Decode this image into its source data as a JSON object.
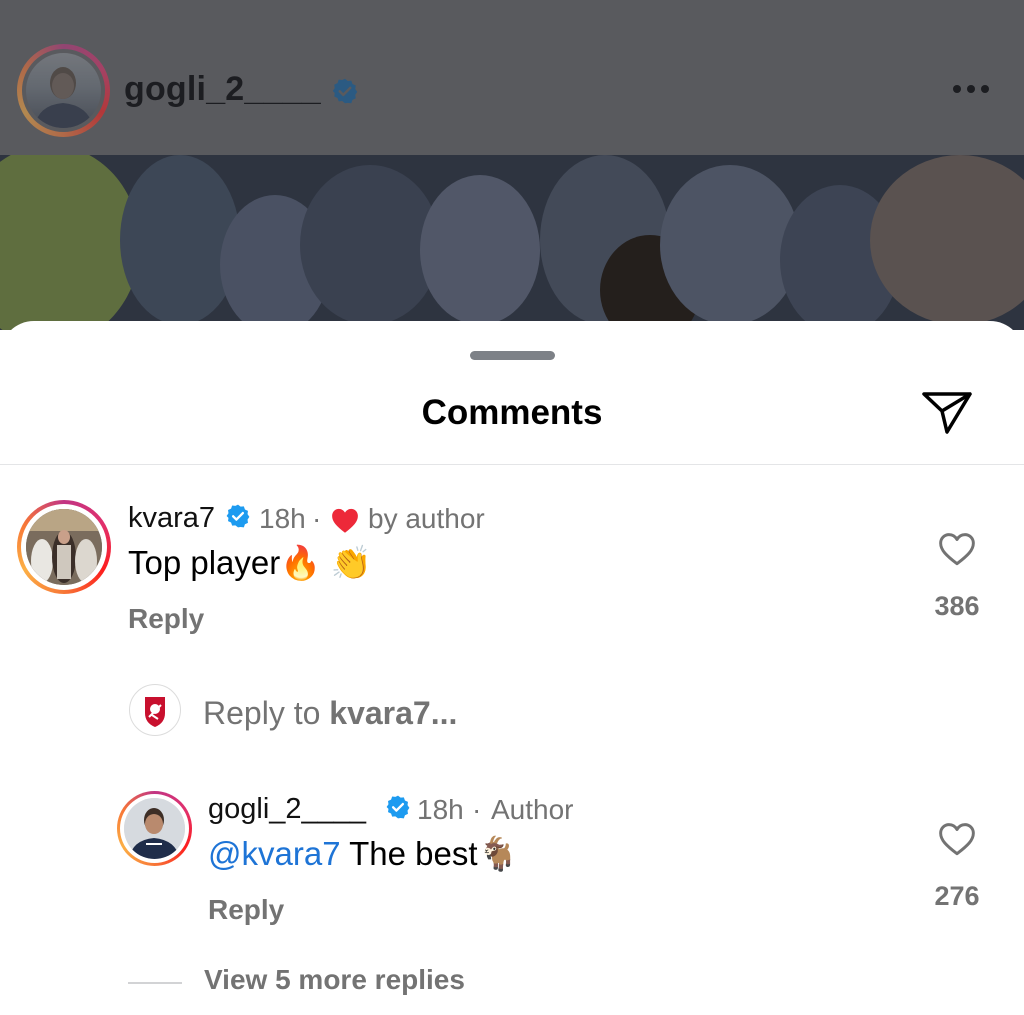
{
  "post": {
    "username": "gogli_2____",
    "verified": true,
    "more_icon": "more-horizontal-icon"
  },
  "sheet": {
    "title": "Comments",
    "share_icon": "send-icon"
  },
  "comments": [
    {
      "username": "kvara7",
      "verified": true,
      "time": "18h",
      "liked_by_author_label": "by author",
      "text": "Top player🔥 👏",
      "reply_label": "Reply",
      "likes": "386"
    }
  ],
  "reply_input": {
    "prefix": "Reply to",
    "target": "kvara7..."
  },
  "replies": [
    {
      "username": "gogli_2____",
      "verified": true,
      "time": "18h",
      "role": "Author",
      "mention": "@kvara7",
      "text": " The best🐐",
      "reply_label": "Reply",
      "likes": "276"
    }
  ],
  "view_more": "View 5 more replies",
  "colors": {
    "verified_blue": "#1d9bf0",
    "mention_blue": "#1e74d6",
    "heart_red": "#ed2939",
    "secondary_text": "#737373"
  }
}
